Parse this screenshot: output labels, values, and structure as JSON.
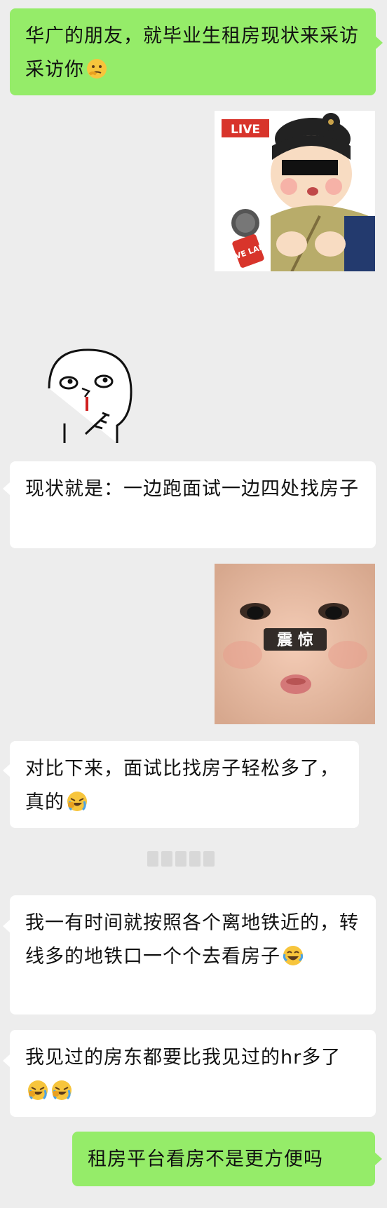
{
  "messages": [
    {
      "side": "right",
      "type": "text",
      "text": "华广的朋友，就毕业生租房现状来采访采访你",
      "emoji": [
        "thinking-emoji"
      ]
    },
    {
      "side": "right",
      "type": "sticker",
      "sticker": "reporter-cartoon",
      "labels": {
        "live": "LIVE",
        "mic": "FIVE LAKE"
      }
    },
    {
      "side": "left",
      "type": "sticker",
      "sticker": "doodle-nosebleed"
    },
    {
      "side": "left",
      "type": "text",
      "text": "现状就是：一边跑面试一边四处找房子"
    },
    {
      "side": "right",
      "type": "sticker",
      "sticker": "baby-shocked",
      "labels": {
        "caption": "震 惊"
      }
    },
    {
      "side": "left",
      "type": "text",
      "text": "对比下来，面试比找房子轻松多了，真的",
      "emoji": [
        "crying-laugh-emoji"
      ]
    },
    {
      "side": "left",
      "type": "text",
      "text": "我一有时间就按照各个离地铁近的，转线多的地铁口一个个去看房子",
      "emoji": [
        "laughing-tears-emoji"
      ]
    },
    {
      "side": "left",
      "type": "text",
      "text": "我见过的房东都要比我见过的hr多了",
      "emoji": [
        "crying-laugh-emoji",
        "crying-laugh-emoji"
      ]
    },
    {
      "side": "right",
      "type": "text",
      "text": "租房平台看房不是更方便吗"
    }
  ],
  "colors": {
    "background": "#ededed",
    "green_bubble": "#95ec69",
    "white_bubble": "#ffffff",
    "text": "#111111"
  }
}
